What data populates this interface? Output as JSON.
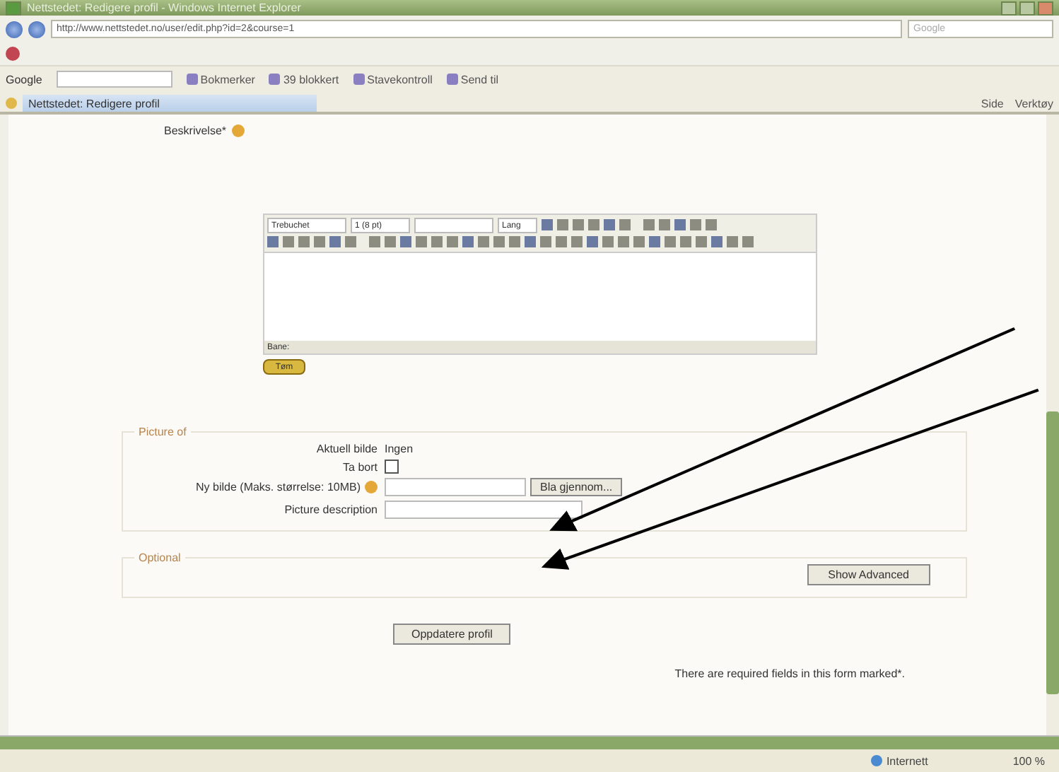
{
  "window": {
    "title": "Nettstedet: Redigere profil - Windows Internet Explorer"
  },
  "address_bar": {
    "url": "http://www.nettstedet.no/user/edit.php?id=2&course=1",
    "search_placeholder": "Google"
  },
  "google_toolbar": {
    "label": "Google",
    "items": [
      "Bokmerker",
      "39 blokkert",
      "Stavekontroll",
      "Send til"
    ]
  },
  "tab": {
    "label": "Nettstedet: Redigere profil"
  },
  "command_bar": [
    "Side",
    "Verktøy"
  ],
  "form": {
    "description_label": "Beskrivelse*",
    "editor": {
      "font": "Trebuchet",
      "size": "1 (8 pt)",
      "lang": "Lang",
      "path": "Bane:",
      "toggle": "Tøm"
    },
    "picture_section": {
      "legend": "Picture of",
      "fields": [
        {
          "kind": "text",
          "label": "Aktuell bilde",
          "value": "Ingen"
        },
        {
          "kind": "checkbox",
          "label": "Ta bort",
          "checked": false
        },
        {
          "kind": "file",
          "label": "Ny bilde (Maks. størrelse: 10MB)",
          "button": "Bla gjennom..."
        },
        {
          "kind": "input",
          "label": "Picture description"
        }
      ]
    },
    "optional_section": {
      "legend": "Optional",
      "button": "Show Advanced"
    },
    "submit": "Oppdatere profil",
    "required_note": "There are required fields in this form marked*."
  },
  "status_bar": {
    "zone": "Internett",
    "zoom": "100 %"
  }
}
